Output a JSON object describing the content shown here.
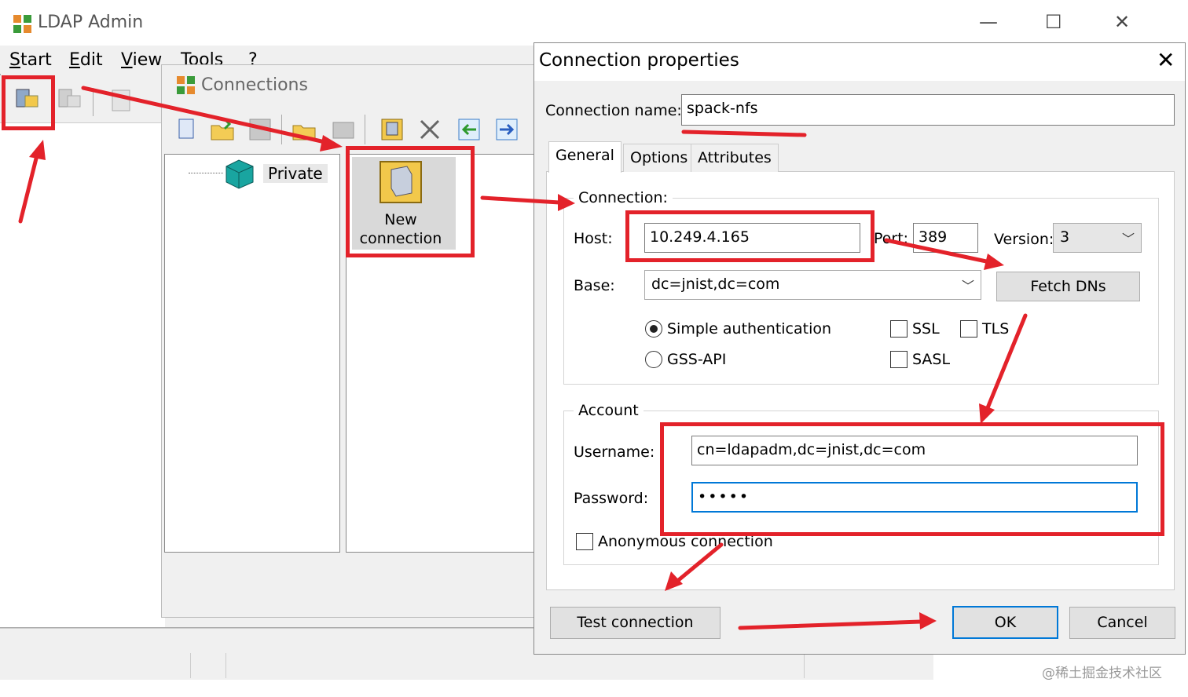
{
  "app": {
    "title": "LDAP Admin",
    "window_controls": {
      "minimize": "—",
      "maximize": "☐",
      "close": "✕"
    }
  },
  "menu": {
    "items": [
      "Start",
      "Edit",
      "View",
      "Tools",
      "?"
    ]
  },
  "connections_window": {
    "title": "Connections",
    "tree": {
      "root": "Private"
    },
    "list": {
      "new_connection_line1": "New",
      "new_connection_line2": "connection"
    }
  },
  "dialog": {
    "title": "Connection properties",
    "close": "✕",
    "connection_name_label": "Connection name:",
    "connection_name_value": "spack-nfs",
    "tabs": [
      "General",
      "Options",
      "Attributes"
    ],
    "active_tab": "General",
    "connection_group": {
      "title": "Connection:",
      "host_label": "Host:",
      "host_value": "10.249.4.165",
      "port_label": "Port:",
      "port_value": "389",
      "version_label": "Version:",
      "version_value": "3",
      "base_label": "Base:",
      "base_value": "dc=jnist,dc=com",
      "fetch_dns": "Fetch DNs",
      "simple_auth": "Simple authentication",
      "gss_api": "GSS-API",
      "ssl": "SSL",
      "tls": "TLS",
      "sasl": "SASL",
      "auth_selected": "Simple authentication"
    },
    "account_group": {
      "title": "Account",
      "username_label": "Username:",
      "username_value": "cn=ldapadm,dc=jnist,dc=com",
      "password_label": "Password:",
      "password_value": "•••••",
      "anonymous": "Anonymous connection"
    },
    "buttons": {
      "test": "Test connection",
      "ok": "OK",
      "cancel": "Cancel"
    }
  },
  "watermark": "@稀土掘金技术社区",
  "colors": {
    "annotation_red": "#e3222a",
    "focus_blue": "#0078d7",
    "window_bg": "#f0f0f0"
  }
}
